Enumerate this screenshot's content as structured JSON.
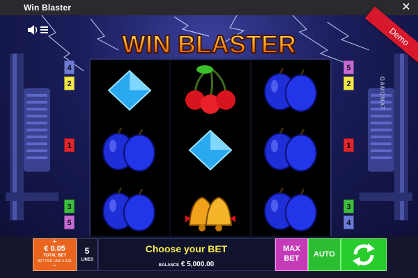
{
  "window": {
    "title": "Win Blaster",
    "close_glyph": "✕"
  },
  "logo": {
    "text": "WIN BLASTER"
  },
  "ribbon": {
    "text": "Demo"
  },
  "watermark": {
    "text": "GAMOMAT"
  },
  "paylines": {
    "left": [
      {
        "label": "4",
        "color": "#6b7bd6"
      },
      {
        "label": "2",
        "color": "#f2e84a"
      },
      {
        "label": "1",
        "color": "#e0252f"
      },
      {
        "label": "3",
        "color": "#3dbd3d"
      },
      {
        "label": "5",
        "color": "#c76ad6"
      }
    ],
    "right": [
      {
        "label": "5",
        "color": "#c76ad6"
      },
      {
        "label": "2",
        "color": "#f2e84a"
      },
      {
        "label": "1",
        "color": "#e0252f"
      },
      {
        "label": "3",
        "color": "#3dbd3d"
      },
      {
        "label": "4",
        "color": "#6b7bd6"
      }
    ]
  },
  "reels": [
    [
      "diamond",
      "plums",
      "plums"
    ],
    [
      "cherries",
      "diamond",
      "bells"
    ],
    [
      "plums",
      "plums",
      "plums"
    ]
  ],
  "bet": {
    "plus": "+",
    "minus": "−",
    "amount": "€ 0.05",
    "label": "TOTAL BET",
    "per_line": "BET PER LINE € 0.01"
  },
  "lines": {
    "count": "5",
    "label": "LINES"
  },
  "message": {
    "text": "Choose your BET",
    "balance_label": "BALANCE",
    "balance_value": "€ 5,000.00"
  },
  "buttons": {
    "max_line1": "MAX",
    "max_line2": "BET",
    "auto": "AUTO"
  },
  "colors": {
    "bet": "#e9641d",
    "max_bet": "#c53bb7",
    "auto": "#2dbd33",
    "spin": "#28cc2d",
    "message_text": "#f7ee52",
    "demo": "#d8182b"
  }
}
